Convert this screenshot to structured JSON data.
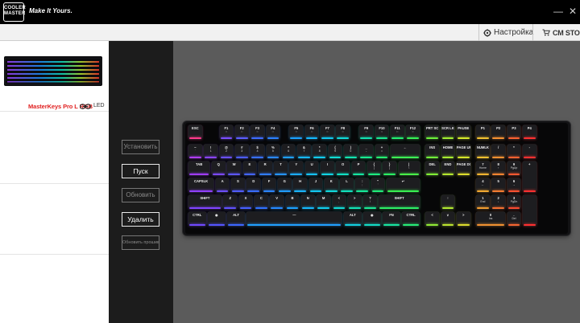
{
  "brand": {
    "logo_text": "COOLER MASTER",
    "tagline": "Make It Yours.",
    "minimize_glyph": "—",
    "close_glyph": "✕"
  },
  "toolbar": {
    "settings_label": "Настройка",
    "settings_icon": "gear-icon",
    "store_label": "CM STORE",
    "store_icon": "cart-icon"
  },
  "device": {
    "name": "MasterKeys Pro L RGB",
    "mode_label": "LED",
    "link_icon": "link-icon"
  },
  "actions": {
    "install": "Установить",
    "launch": "Пуск",
    "update": "Обновить",
    "remove": "Удалить",
    "firmware": "Обновить прошивку"
  },
  "keyboard": {
    "fn_row": [
      {
        "label": "ESC",
        "sub": "",
        "color": "#ff3a8c"
      },
      {
        "label": "F1",
        "sub": "◦◦",
        "color": "#7a4dff"
      },
      {
        "label": "F2",
        "sub": "◦◦",
        "color": "#5a5dff"
      },
      {
        "label": "F3",
        "sub": "◦◦",
        "color": "#3d6bff"
      },
      {
        "label": "F4",
        "sub": "◦◦",
        "color": "#2b80ff"
      },
      {
        "label": "F5",
        "sub": "◦◦",
        "color": "#1aa0ff"
      },
      {
        "label": "F6",
        "sub": "◦◦",
        "color": "#13b8ff"
      },
      {
        "label": "F7",
        "sub": "◦◦",
        "color": "#10c8f0"
      },
      {
        "label": "F8",
        "sub": "◦◦",
        "color": "#10d8d8"
      },
      {
        "label": "F9",
        "sub": "◦◦",
        "color": "#12e0b0"
      },
      {
        "label": "F10",
        "sub": "◦◦",
        "color": "#18e890"
      },
      {
        "label": "F11",
        "sub": "◦◦",
        "color": "#22ee70"
      },
      {
        "label": "F12",
        "sub": "◦◦",
        "color": "#36f055"
      },
      {
        "label": "PRT SC",
        "sub": "",
        "color": "#6cf03a"
      },
      {
        "label": "SCR LK",
        "sub": "",
        "color": "#a0ee30"
      },
      {
        "label": "PAUSE",
        "sub": "",
        "color": "#d4e82a"
      },
      {
        "label": "P1",
        "sub": "",
        "color": "#f0c030"
      },
      {
        "label": "P2",
        "sub": "",
        "color": "#f59030"
      },
      {
        "label": "P3",
        "sub": "",
        "color": "#f86030"
      },
      {
        "label": "P4",
        "sub": "",
        "color": "#ff3030"
      }
    ],
    "num_row": [
      {
        "label": "~",
        "sub": "`",
        "color": "#b03cff"
      },
      {
        "label": "!",
        "sub": "1",
        "color": "#8a44ff"
      },
      {
        "label": "@",
        "sub": "2",
        "color": "#6a50ff"
      },
      {
        "label": "#",
        "sub": "3",
        "color": "#4c5cff"
      },
      {
        "label": "$",
        "sub": "4",
        "color": "#3870ff"
      },
      {
        "label": "%",
        "sub": "5",
        "color": "#2a88ff"
      },
      {
        "label": "^",
        "sub": "6",
        "color": "#1ea0ff"
      },
      {
        "label": "&",
        "sub": "7",
        "color": "#16b8ff"
      },
      {
        "label": "*",
        "sub": "8",
        "color": "#10ccf0"
      },
      {
        "label": "(",
        "sub": "9",
        "color": "#10dcd4"
      },
      {
        "label": ")",
        "sub": "0",
        "color": "#12e4b0"
      },
      {
        "label": "_",
        "sub": "-",
        "color": "#18ea90"
      },
      {
        "label": "+",
        "sub": "=",
        "color": "#24ee70"
      },
      {
        "label": "←",
        "sub": "",
        "color": "#3cf055"
      },
      {
        "label": "INS",
        "sub": "",
        "color": "#70ee3a"
      },
      {
        "label": "HOME",
        "sub": "",
        "color": "#a6ea30"
      },
      {
        "label": "PAGE UP",
        "sub": "",
        "color": "#d4e42a"
      },
      {
        "label": "NUMLK",
        "sub": "",
        "color": "#f2c030"
      },
      {
        "label": "/",
        "sub": "",
        "color": "#f69030"
      },
      {
        "label": "*",
        "sub": "",
        "color": "#f86030"
      },
      {
        "label": "-",
        "sub": "",
        "color": "#ff3030"
      }
    ],
    "tab_row": [
      {
        "label": "TAB",
        "sub": "",
        "color": "#a03cff"
      },
      {
        "label": "Q",
        "sub": "",
        "color": "#7c48ff"
      },
      {
        "label": "W",
        "sub": "",
        "color": "#5c56ff"
      },
      {
        "label": "E",
        "sub": "",
        "color": "#4264ff"
      },
      {
        "label": "R",
        "sub": "",
        "color": "#307cff"
      },
      {
        "label": "T",
        "sub": "",
        "color": "#2494ff"
      },
      {
        "label": "Y",
        "sub": "",
        "color": "#1aacff"
      },
      {
        "label": "U",
        "sub": "",
        "color": "#14c2f8"
      },
      {
        "label": "I",
        "sub": "",
        "color": "#10d4e4"
      },
      {
        "label": "O",
        "sub": "",
        "color": "#10e0c4"
      },
      {
        "label": "P",
        "sub": "",
        "color": "#14e6a0"
      },
      {
        "label": "{",
        "sub": "[",
        "color": "#1cec80"
      },
      {
        "label": "}",
        "sub": "]",
        "color": "#2aee62"
      },
      {
        "label": "|",
        "sub": "\\",
        "color": "#48f048"
      },
      {
        "label": "DEL",
        "sub": "",
        "color": "#80ee34"
      },
      {
        "label": "END",
        "sub": "",
        "color": "#b4e82e"
      },
      {
        "label": "PAGE DOWN",
        "sub": "",
        "color": "#dede2c"
      },
      {
        "label": "7",
        "sub": "Home",
        "color": "#f4b430"
      },
      {
        "label": "8",
        "sub": "↑",
        "color": "#f78430"
      },
      {
        "label": "9",
        "sub": "PgUp",
        "color": "#fa5830"
      },
      {
        "label": "+",
        "sub": "",
        "color": "#ff3030"
      }
    ],
    "caps_row": [
      {
        "label": "CAPSLK",
        "sub": "",
        "color": "#9040ff"
      },
      {
        "label": "A",
        "sub": "",
        "color": "#6c4eff"
      },
      {
        "label": "S",
        "sub": "",
        "color": "#505cff"
      },
      {
        "label": "D",
        "sub": "",
        "color": "#386cff"
      },
      {
        "label": "F",
        "sub": "",
        "color": "#2a84ff"
      },
      {
        "label": "G",
        "sub": "",
        "color": "#209cff"
      },
      {
        "label": "H",
        "sub": "",
        "color": "#18b4ff"
      },
      {
        "label": "J",
        "sub": "",
        "color": "#12c8f0"
      },
      {
        "label": "K",
        "sub": "",
        "color": "#10d8dc"
      },
      {
        "label": "L",
        "sub": "",
        "color": "#10e2bc"
      },
      {
        "label": ":",
        "sub": ";",
        "color": "#16e898"
      },
      {
        "label": "\"",
        "sub": "'",
        "color": "#20ec78"
      },
      {
        "label": "↵",
        "sub": "",
        "color": "#38f050"
      },
      {
        "label": "4",
        "sub": "←",
        "color": "#f2a830"
      },
      {
        "label": "5",
        "sub": "",
        "color": "#f67c30"
      },
      {
        "label": "6",
        "sub": "→",
        "color": "#f95030"
      }
    ],
    "shift_row": [
      {
        "label": "SHIFT",
        "sub": "",
        "color": "#8044ff"
      },
      {
        "label": "Z",
        "sub": "",
        "color": "#6050ff"
      },
      {
        "label": "X",
        "sub": "",
        "color": "#465eff"
      },
      {
        "label": "C",
        "sub": "",
        "color": "#3070ff"
      },
      {
        "label": "V",
        "sub": "",
        "color": "#2488ff"
      },
      {
        "label": "B",
        "sub": "",
        "color": "#1aa0ff"
      },
      {
        "label": "N",
        "sub": "",
        "color": "#14b8fc"
      },
      {
        "label": "M",
        "sub": "",
        "color": "#10ccec"
      },
      {
        "label": "<",
        "sub": ",",
        "color": "#10dad4"
      },
      {
        "label": ">",
        "sub": ".",
        "color": "#12e2b4"
      },
      {
        "label": "?",
        "sub": "/",
        "color": "#1ae894"
      },
      {
        "label": "SHIFT",
        "sub": "",
        "color": "#2cee66"
      },
      {
        "label": "↑",
        "sub": "",
        "color": "#b0e830"
      },
      {
        "label": "1",
        "sub": "End",
        "color": "#f09c30"
      },
      {
        "label": "2",
        "sub": "↓",
        "color": "#f47030"
      },
      {
        "label": "3",
        "sub": "PgDn",
        "color": "#f84a30"
      },
      {
        "label": "",
        "sub": "",
        "color": "#ff3030"
      }
    ],
    "ctrl_row": [
      {
        "label": "CTRL",
        "sub": "",
        "color": "#7048ff"
      },
      {
        "label": "◉",
        "sub": "",
        "color": "#5454ff"
      },
      {
        "label": "ALT",
        "sub": "",
        "color": "#3c66ff"
      },
      {
        "label": "—",
        "sub": "",
        "color": "#20a0ff"
      },
      {
        "label": "ALT",
        "sub": "",
        "color": "#12d0e0"
      },
      {
        "label": "◉",
        "sub": "",
        "color": "#12dcc4"
      },
      {
        "label": "FN",
        "sub": "",
        "color": "#18e6a0"
      },
      {
        "label": "CTRL",
        "sub": "",
        "color": "#26ec76"
      },
      {
        "label": "<",
        "sub": "",
        "color": "#90ea34"
      },
      {
        "label": "∨",
        "sub": "",
        "color": "#bce42e"
      },
      {
        "label": ">",
        "sub": "",
        "color": "#dcdc2c"
      },
      {
        "label": "0",
        "sub": "Ins",
        "color": "#f09030"
      },
      {
        "label": ".",
        "sub": "Del",
        "color": "#f66430"
      }
    ]
  }
}
